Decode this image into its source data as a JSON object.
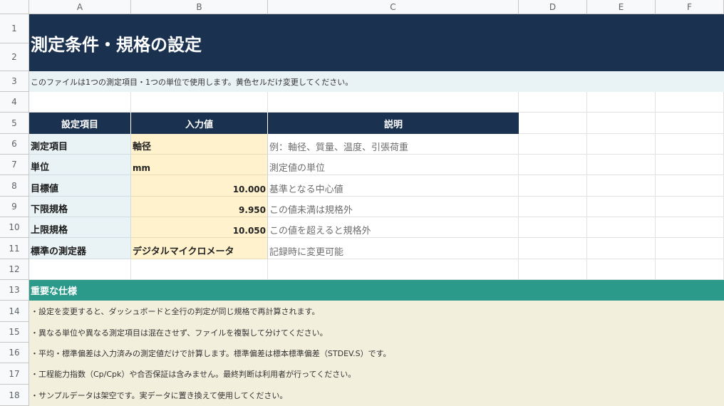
{
  "columns": [
    "A",
    "B",
    "C",
    "D",
    "E",
    "F"
  ],
  "rows": [
    "1",
    "2",
    "3",
    "4",
    "5",
    "6",
    "7",
    "8",
    "9",
    "10",
    "11",
    "12",
    "13",
    "14",
    "15",
    "16",
    "17",
    "18"
  ],
  "title": "測定条件・規格の設定",
  "note": "このファイルは1つの測定項目・1つの単位で使用します。黄色セルだけ変更してください。",
  "table_headers": {
    "item": "設定項目",
    "value": "入力値",
    "description": "説明"
  },
  "settings": [
    {
      "label": "測定項目",
      "value": "軸径",
      "description": "例：軸径、質量、温度、引張荷重"
    },
    {
      "label": "単位",
      "value": "mm",
      "description": "測定値の単位"
    },
    {
      "label": "目標値",
      "value": "10.000",
      "description": "基準となる中心値"
    },
    {
      "label": "下限規格",
      "value": "9.950",
      "description": "この値未満は規格外"
    },
    {
      "label": "上限規格",
      "value": "10.050",
      "description": "この値を超えると規格外"
    },
    {
      "label": "標準の測定器",
      "value": "デジタルマイクロメータ",
      "description": "記録時に変更可能"
    }
  ],
  "specs_title": "重要な仕様",
  "specs": [
    "・設定を変更すると、ダッシュボードと全行の判定が同じ規格で再計算されます。",
    "・異なる単位や異なる測定項目は混在させず、ファイルを複製して分けてください。",
    "・平均・標準偏差は入力済みの測定値だけで計算します。標準偏差は標本標準偏差（STDEV.S）です。",
    "・工程能力指数（Cp/Cpk）や合否保証は含みません。最終判断は利用者が行ってください。",
    "・サンプルデータは架空です。実データに置き換えて使用してください。"
  ],
  "colors": {
    "title_bg": "#1b3150",
    "input_bg": "#fff2cc",
    "label_bg": "#e9f2f4",
    "section_bg": "#2b9a8a",
    "spec_bg": "#f3efdd"
  }
}
